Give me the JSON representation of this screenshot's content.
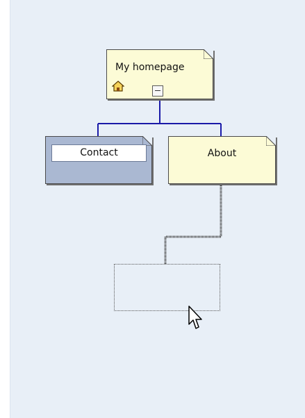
{
  "sitemap": {
    "root_node": {
      "label": "My homepage",
      "icon": "home-icon",
      "toggle": "collapse-toggle"
    },
    "child_nodes": [
      {
        "label": "Contact",
        "state": "selected"
      },
      {
        "label": "About",
        "state": "dragging"
      }
    ],
    "drop_placeholder": {
      "label": ""
    }
  },
  "colors": {
    "canvas_background": "#e8eff7",
    "node_fill": "#fcfbd6",
    "selected_node_fill": "#aab8d2",
    "connector_line": "#1a1aa8"
  }
}
